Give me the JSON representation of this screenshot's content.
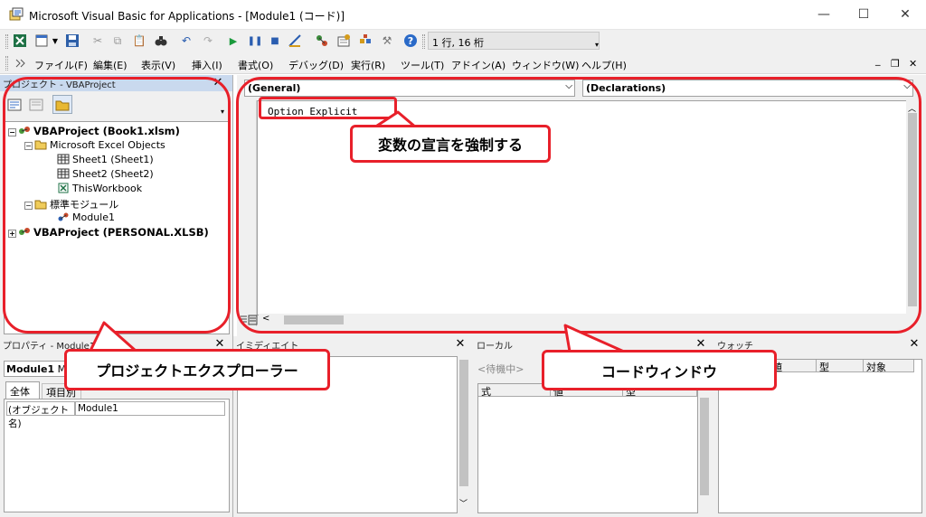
{
  "window": {
    "title": "Microsoft Visual Basic for Applications - [Module1 (コード)]",
    "minimize": "—",
    "maximize": "☐",
    "close": "✕"
  },
  "toolbar": {
    "position_text": "1 行, 16 桁"
  },
  "menu": {
    "items": [
      "ファイル(F)",
      "編集(E)",
      "表示(V)",
      "挿入(I)",
      "書式(O)",
      "デバッグ(D)",
      "実行(R)",
      "ツール(T)",
      "アドイン(A)",
      "ウィンドウ(W)",
      "ヘルプ(H)"
    ],
    "mdi_min": "_",
    "mdi_restore": "❐",
    "mdi_close": "✕"
  },
  "project": {
    "title": "プロジェクト - VBAProject",
    "tree": [
      {
        "label": "VBAProject (Book1.xlsm)",
        "bold": true
      },
      {
        "label": "Microsoft Excel Objects"
      },
      {
        "label": "Sheet1 (Sheet1)"
      },
      {
        "label": "Sheet2 (Sheet2)"
      },
      {
        "label": "ThisWorkbook"
      },
      {
        "label": "標準モジュール"
      },
      {
        "label": "Module1"
      },
      {
        "label": "VBAProject (PERSONAL.XLSB)",
        "bold": true
      }
    ]
  },
  "code": {
    "object_combo": "(General)",
    "proc_combo": "(Declarations)",
    "line1": "Option Explicit"
  },
  "properties": {
    "title": "プロパティ - Module1",
    "object": "Module1",
    "object_type_partial": "Mo",
    "tab_all": "全体",
    "tab_category": "項目別",
    "prop_name": "(オブジェクト名)",
    "prop_value": "Module1"
  },
  "immediate": {
    "title": "イミディエイト"
  },
  "locals": {
    "title": "ローカル",
    "status": "<待機中>",
    "col_expr": "式",
    "col_value": "値",
    "col_type": "型"
  },
  "watch": {
    "title": "ウォッチ",
    "col_value": "値",
    "col_type": "型",
    "col_context": "対象"
  },
  "annotations": {
    "code_note": "変数の宣言を強制する",
    "project_explorer": "プロジェクトエクスプローラー",
    "code_window": "コードウィンドウ"
  },
  "colors": {
    "accent_red": "#e8202a",
    "pane_title_bg": "#c9d9ee",
    "chrome": "#f0f0f0"
  }
}
